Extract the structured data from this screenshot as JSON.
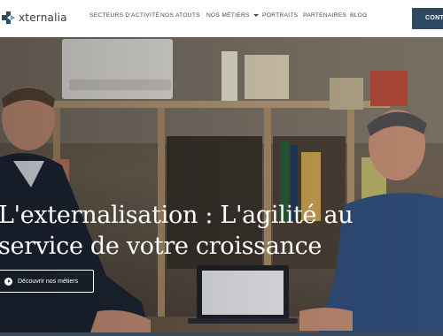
{
  "brand": {
    "name": "xternalia",
    "accent": "#2f4a63",
    "logo_icon": "puzzle-arrow-logo"
  },
  "nav": {
    "items": [
      {
        "label": "SECTEURS D'ACTIVITÉ"
      },
      {
        "label": "NOS ATOUTS"
      },
      {
        "label": "NOS MÉTIERS"
      },
      {
        "label": "PORTRAITS"
      },
      {
        "label": "PARTENAIRES"
      },
      {
        "label": "BLOG"
      }
    ],
    "cta_label": "CONTA"
  },
  "hero": {
    "headline_line1": "L'externalisation : L'agilité au",
    "headline_line2": "service de votre croissance",
    "button_label": "Découvrir nos métiers",
    "button_icon": "play-circle-icon"
  }
}
